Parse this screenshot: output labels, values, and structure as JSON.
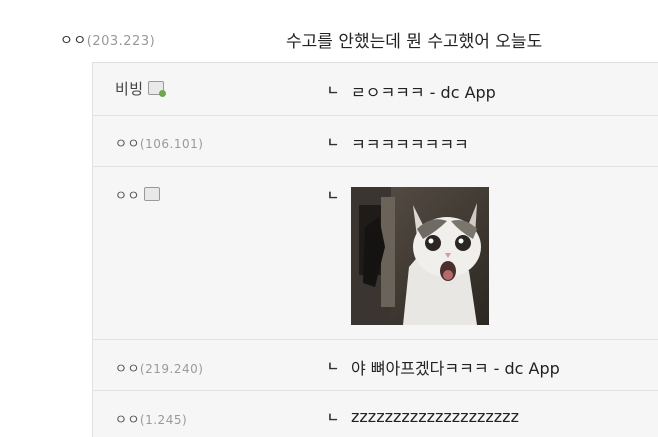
{
  "post": {
    "author": "ㅇㅇ",
    "ip": "(203.223)",
    "text": "수고를 안했는데 뭔 수고했어 오늘도"
  },
  "replies": [
    {
      "author": "비빙",
      "ip": "",
      "badge": "fixed-nick-badge",
      "marker": "ㄴ",
      "text": "ㄹㅇㅋㅋㅋ - dc App"
    },
    {
      "author": "ㅇㅇ",
      "ip": "(106.101)",
      "marker": "ㄴ",
      "text": "ㅋㅋㅋㅋㅋㅋㅋㅋ"
    },
    {
      "author": "ㅇㅇ",
      "ip": "",
      "badge": "mobile-badge",
      "marker": "ㄴ",
      "image": "shocked-cat-dccon"
    },
    {
      "author": "ㅇㅇ",
      "ip": "(219.240)",
      "marker": "ㄴ",
      "text": "야 뼈아프겠다ㅋㅋㅋ - dc App"
    },
    {
      "author": "ㅇㅇ",
      "ip": "(1.245)",
      "marker": "ㄴ",
      "text": "zzzzzzzzzzzzzzzzzzzz"
    }
  ]
}
